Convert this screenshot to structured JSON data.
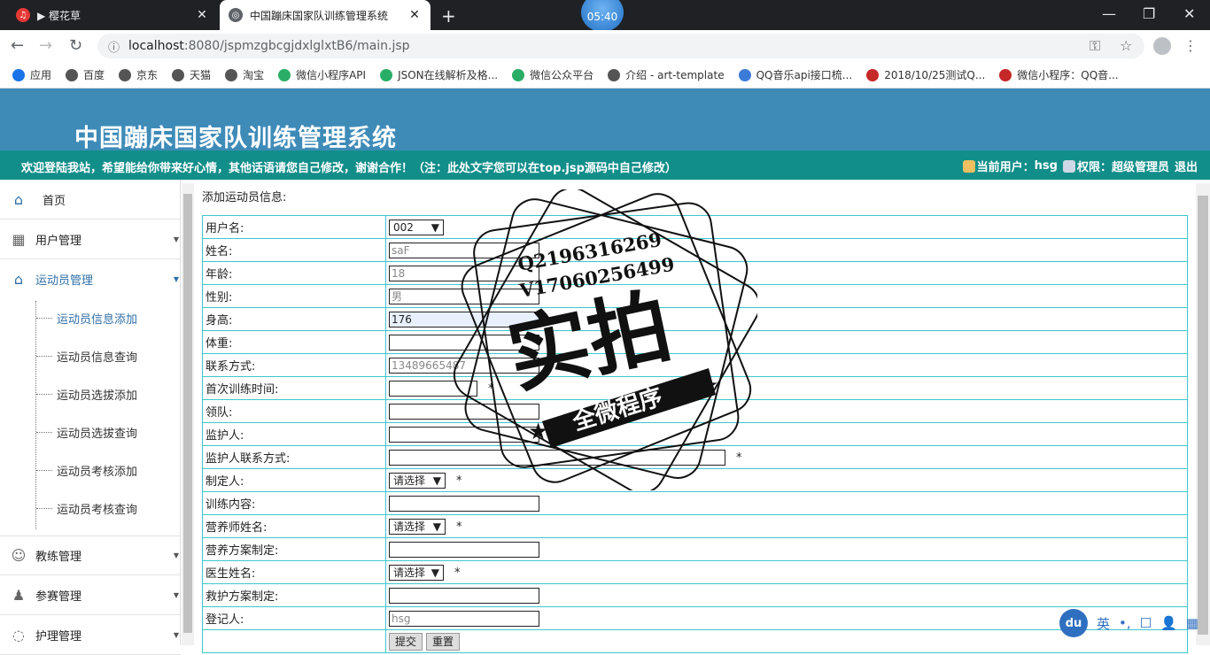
{
  "browser": {
    "tabs": [
      {
        "title": "▶ 樱花草",
        "close": "✕"
      },
      {
        "title": "中国蹦床国家队训练管理系统",
        "close": "✕"
      }
    ],
    "new_tab": "+",
    "clock": "05:40",
    "window_controls": [
      "—",
      "❐",
      "✕"
    ],
    "url_host": "localhost",
    "url_path": ":8080/jspmzgbcgjdxlglxtB6/main.jsp",
    "bookmarks": [
      {
        "label": "应用",
        "color": "#1a73e8"
      },
      {
        "label": "百度",
        "color": "#555555"
      },
      {
        "label": "京东",
        "color": "#555555"
      },
      {
        "label": "天猫",
        "color": "#555555"
      },
      {
        "label": "淘宝",
        "color": "#555555"
      },
      {
        "label": "微信小程序API",
        "color": "#2aae67"
      },
      {
        "label": "JSON在线解析及格...",
        "color": "#2aae67"
      },
      {
        "label": "微信公众平台",
        "color": "#2aae67"
      },
      {
        "label": "介绍 - art-template",
        "color": "#555555"
      },
      {
        "label": "QQ音乐api接口梳...",
        "color": "#3d7bd9"
      },
      {
        "label": "2018/10/25测试Q...",
        "color": "#c62828"
      },
      {
        "label": "微信小程序：QQ音...",
        "color": "#c62828"
      }
    ]
  },
  "header": {
    "title": "中国蹦床国家队训练管理系统",
    "welcome": "欢迎登陆我站，希望能给你带来好心情，其他话语请您自己修改，谢谢合作！（注：此处文字您可以在top.jsp源码中自己修改）",
    "current_user_label": "当前用户：",
    "current_user": "hsg",
    "permission_label": "权限：",
    "permission": "超级管理员",
    "logout": "退出"
  },
  "sidebar": {
    "home": "首页",
    "menus": [
      "用户管理",
      "运动员管理",
      "教练管理",
      "参赛管理",
      "护理管理"
    ],
    "submenu": [
      "运动员信息添加",
      "运动员信息查询",
      "运动员选拔添加",
      "运动员选拔查询",
      "运动员考核添加",
      "运动员考核查询"
    ]
  },
  "form": {
    "caption": "添加运动员信息:",
    "rows": [
      {
        "label": "用户名:",
        "value": "002"
      },
      {
        "label": "姓名:",
        "value": "saF"
      },
      {
        "label": "年龄:",
        "value": "18"
      },
      {
        "label": "性别:",
        "value": "男"
      },
      {
        "label": "身高:",
        "value": "176"
      },
      {
        "label": "体重:",
        "value": ""
      },
      {
        "label": "联系方式:",
        "value": "13489665487"
      },
      {
        "label": "首次训练时间:",
        "value": ""
      },
      {
        "label": "领队:",
        "value": ""
      },
      {
        "label": "监护人:",
        "value": ""
      },
      {
        "label": "监护人联系方式:",
        "value": ""
      },
      {
        "label": "制定人:",
        "value": "请选择"
      },
      {
        "label": "训练内容:",
        "value": ""
      },
      {
        "label": "营养师姓名:",
        "value": "请选择"
      },
      {
        "label": "营养方案制定:",
        "value": ""
      },
      {
        "label": "医生姓名:",
        "value": "请选择"
      },
      {
        "label": "救护方案制定:",
        "value": ""
      },
      {
        "label": "登记人:",
        "value": "hsg"
      }
    ],
    "required_mark": "*",
    "submit": "提交",
    "reset": "重置"
  },
  "watermark": {
    "line1": "Q2196316269",
    "line2": "V17060256499",
    "big": "实拍",
    "banner": "全微程序"
  },
  "ime": {
    "logo": "du",
    "items": [
      "英",
      "•,",
      "☐",
      "👤",
      "▦"
    ]
  }
}
